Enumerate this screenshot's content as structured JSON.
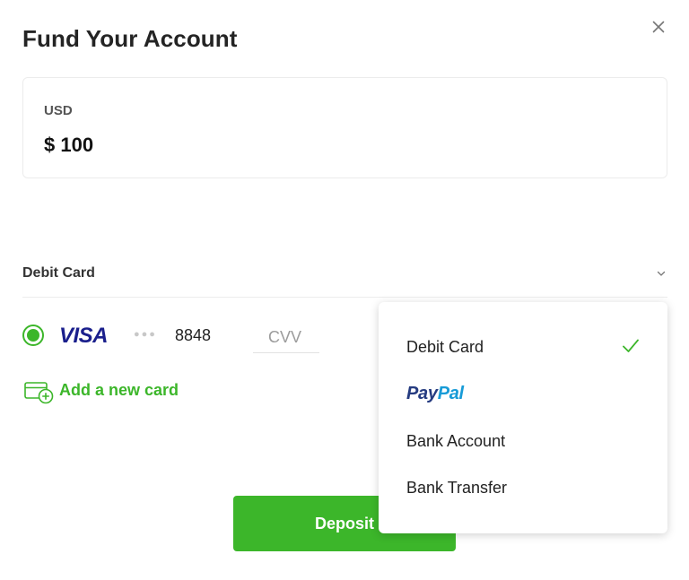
{
  "modal": {
    "title": "Fund Your Account"
  },
  "amount": {
    "currency": "USD",
    "value": "$ 100"
  },
  "payment_method": {
    "selected": "Debit Card"
  },
  "card": {
    "brand": "VISA",
    "masked_dots": "●●●",
    "last4": "8848",
    "cvv_placeholder": "CVV"
  },
  "add_card": {
    "label": "Add a new card"
  },
  "deposit_button": {
    "label": "Deposit"
  },
  "dropdown": {
    "options": [
      {
        "label": "Debit Card",
        "selected": true
      },
      {
        "label_part1": "Pay",
        "label_part2": "Pal"
      },
      {
        "label": "Bank Account"
      },
      {
        "label": "Bank Transfer"
      }
    ]
  },
  "colors": {
    "accent": "#3cb62a",
    "visa_blue": "#1a1f8c",
    "paypal_dark": "#253b80",
    "paypal_light": "#179bd7"
  },
  "icons": {
    "close": "close-icon",
    "chevron": "chevron-down-icon",
    "add_card": "add-card-icon",
    "check": "check-icon"
  }
}
